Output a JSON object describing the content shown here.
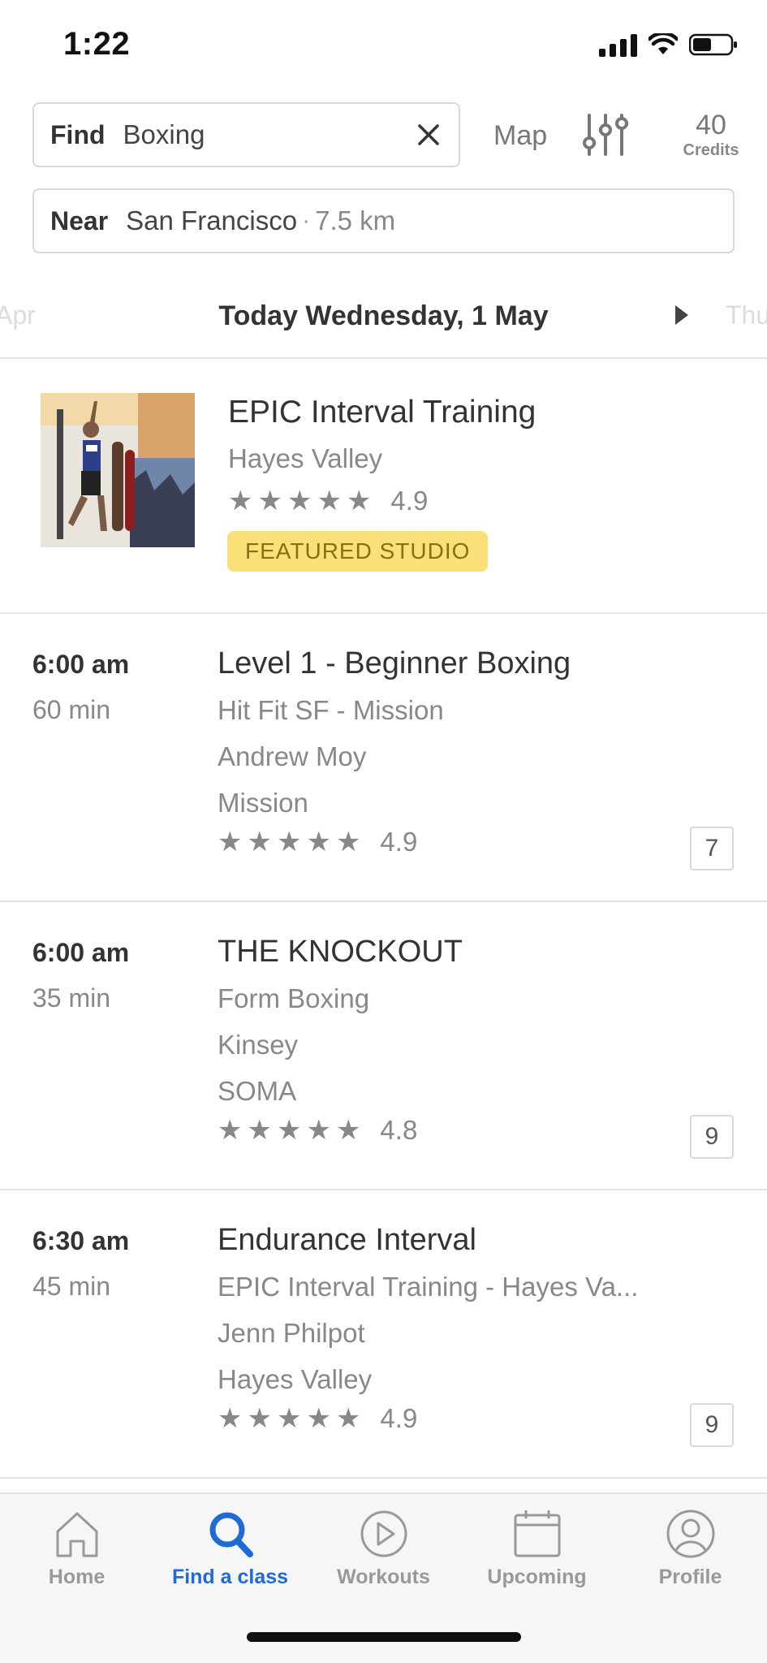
{
  "status_bar": {
    "time": "1:22"
  },
  "search": {
    "find_label": "Find",
    "find_value": "Boxing",
    "map_label": "Map",
    "credits_value": "40",
    "credits_label": "Credits",
    "near_label": "Near",
    "near_city": "San Francisco",
    "near_separator": "·",
    "near_distance": "7.5 km"
  },
  "date_strip": {
    "prev": "Apr",
    "current": "Today Wednesday, 1 May",
    "next": "Thu"
  },
  "featured": {
    "name": "EPIC Interval Training",
    "area": "Hayes Valley",
    "rating": "4.9",
    "stars": 5,
    "badge": "FEATURED STUDIO"
  },
  "classes": [
    {
      "time": "6:00 am",
      "duration": "60 min",
      "name": "Level 1 - Beginner Boxing",
      "studio": "Hit Fit SF - Mission",
      "instructor": "Andrew Moy",
      "neighborhood": "Mission",
      "rating": "4.9",
      "credits": "7"
    },
    {
      "time": "6:00 am",
      "duration": "35 min",
      "name": "THE KNOCKOUT",
      "studio": "Form Boxing",
      "instructor": "Kinsey",
      "neighborhood": "SOMA",
      "rating": "4.8",
      "credits": "9"
    },
    {
      "time": "6:30 am",
      "duration": "45 min",
      "name": "Endurance Interval",
      "studio": "EPIC Interval Training - Hayes Va...",
      "instructor": "Jenn Philpot",
      "neighborhood": "Hayes Valley",
      "rating": "4.9",
      "credits": "9"
    }
  ],
  "tabs": [
    {
      "label": "Home",
      "icon": "home-icon",
      "active": false
    },
    {
      "label": "Find a class",
      "icon": "search-icon",
      "active": true
    },
    {
      "label": "Workouts",
      "icon": "play-icon",
      "active": false
    },
    {
      "label": "Upcoming",
      "icon": "calendar-icon",
      "active": false
    },
    {
      "label": "Profile",
      "icon": "person-icon",
      "active": false
    }
  ],
  "colors": {
    "accent": "#1e6bd6",
    "badge_bg": "#fbe07a",
    "badge_text": "#8a6d14"
  }
}
